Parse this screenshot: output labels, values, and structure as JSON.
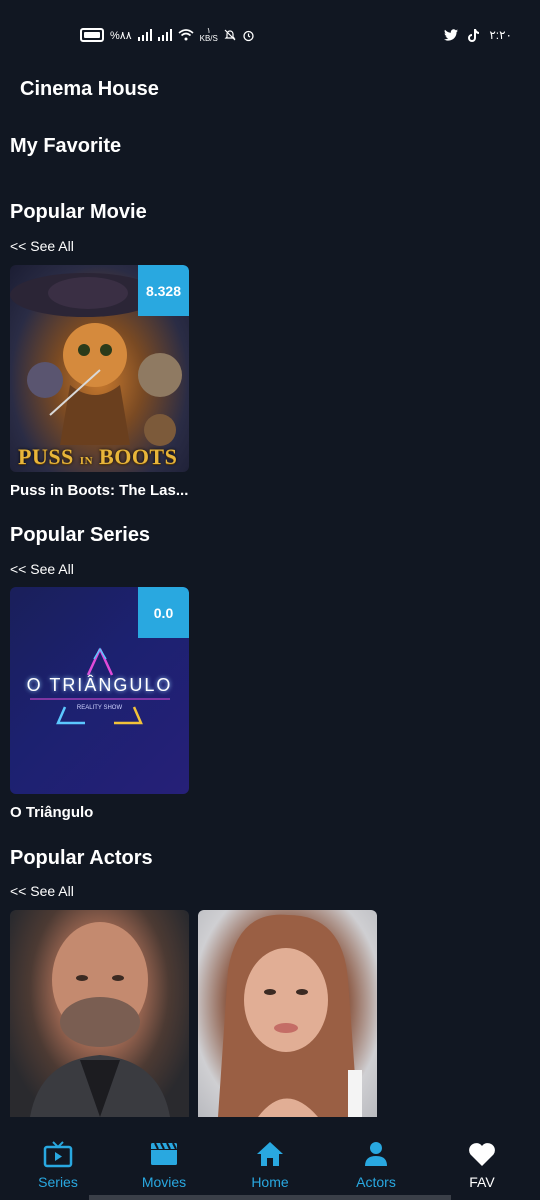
{
  "status_bar": {
    "battery_text": "%٨٨",
    "network_speed": "KB/S",
    "speed_value": "١",
    "time": "٢:٢٠"
  },
  "app": {
    "title": "Cinema House"
  },
  "sections": {
    "favorite": {
      "title": "My Favorite"
    },
    "popular_movie": {
      "title": "Popular Movie",
      "see_all": "<< See All",
      "items": [
        {
          "title": "Puss in Boots: The Las...",
          "rating": "8.328",
          "poster_text_1": "PUSS",
          "poster_text_2": "IN",
          "poster_text_3": "BOOTS"
        }
      ]
    },
    "popular_series": {
      "title": "Popular Series",
      "see_all": "<< See All",
      "items": [
        {
          "title": "O Triângulo",
          "rating": "0.0",
          "poster_text": "O TRIÂNGULO",
          "poster_subtext": "REALITY SHOW"
        }
      ]
    },
    "popular_actors": {
      "title": "Popular Actors",
      "see_all": "<< See All"
    }
  },
  "bottom_nav": {
    "items": [
      {
        "label": "Series",
        "icon": "tv-icon"
      },
      {
        "label": "Movies",
        "icon": "clapperboard-icon"
      },
      {
        "label": "Home",
        "icon": "home-icon"
      },
      {
        "label": "Actors",
        "icon": "person-icon"
      },
      {
        "label": "FAV",
        "icon": "heart-icon"
      }
    ],
    "active": "FAV",
    "accent_color": "#29a8e0"
  }
}
